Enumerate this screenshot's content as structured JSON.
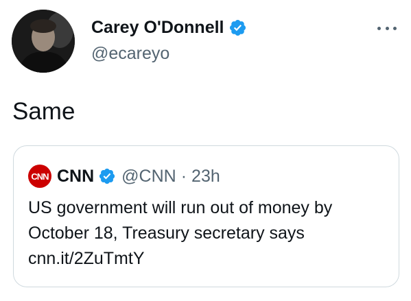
{
  "author": {
    "name": "Carey O'Donnell",
    "handle": "@ecareyo",
    "verified": true
  },
  "tweet": {
    "text": "Same"
  },
  "quoted_tweet": {
    "logo_text": "CNN",
    "author_name": "CNN",
    "author_handle": "@CNN",
    "separator": "·",
    "time": "23h",
    "verified": true,
    "text_lines": [
      "US government will run out of money by",
      "October 18, Treasury secretary says",
      "cnn.it/2ZuTmtY"
    ]
  },
  "icons": {
    "more": "more-horizontal-icon",
    "verified": "verified-badge-icon"
  },
  "colors": {
    "text": "#0f1419",
    "muted": "#536471",
    "verified_blue": "#1d9bf0",
    "cnn_red": "#cc0000",
    "border": "#cfd9de"
  }
}
